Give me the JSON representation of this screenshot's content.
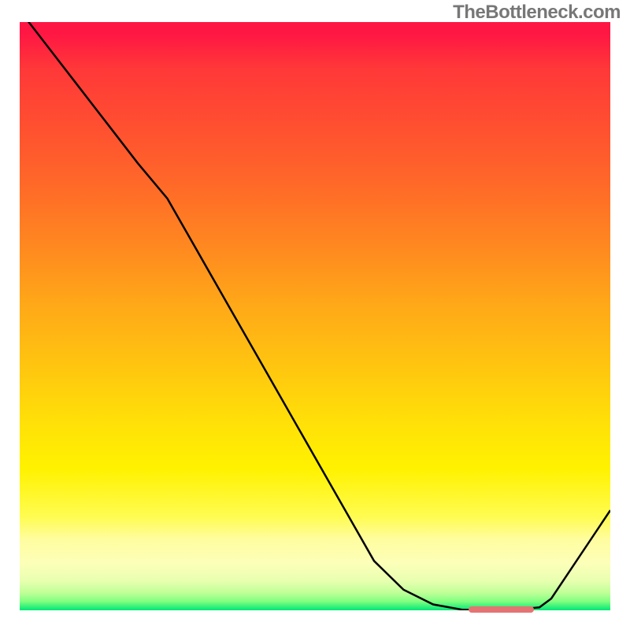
{
  "watermark": "TheBottleneck.com",
  "chart_data": {
    "type": "line",
    "title": "",
    "xlabel": "",
    "ylabel": "",
    "x": [
      0.0,
      0.05,
      0.1,
      0.15,
      0.2,
      0.25,
      0.3,
      0.35,
      0.4,
      0.45,
      0.5,
      0.55,
      0.6,
      0.65,
      0.7,
      0.75,
      0.8,
      0.83,
      0.88,
      0.9,
      1.0
    ],
    "values": [
      1.02,
      0.955,
      0.89,
      0.825,
      0.76,
      0.7,
      0.612,
      0.524,
      0.436,
      0.348,
      0.26,
      0.172,
      0.084,
      0.035,
      0.01,
      0.001,
      0.0,
      0.0,
      0.005,
      0.02,
      0.17
    ],
    "xlim": [
      0,
      1
    ],
    "ylim": [
      0,
      1
    ],
    "marker": {
      "x_start": 0.76,
      "x_end": 0.87,
      "y": 0.002
    }
  }
}
